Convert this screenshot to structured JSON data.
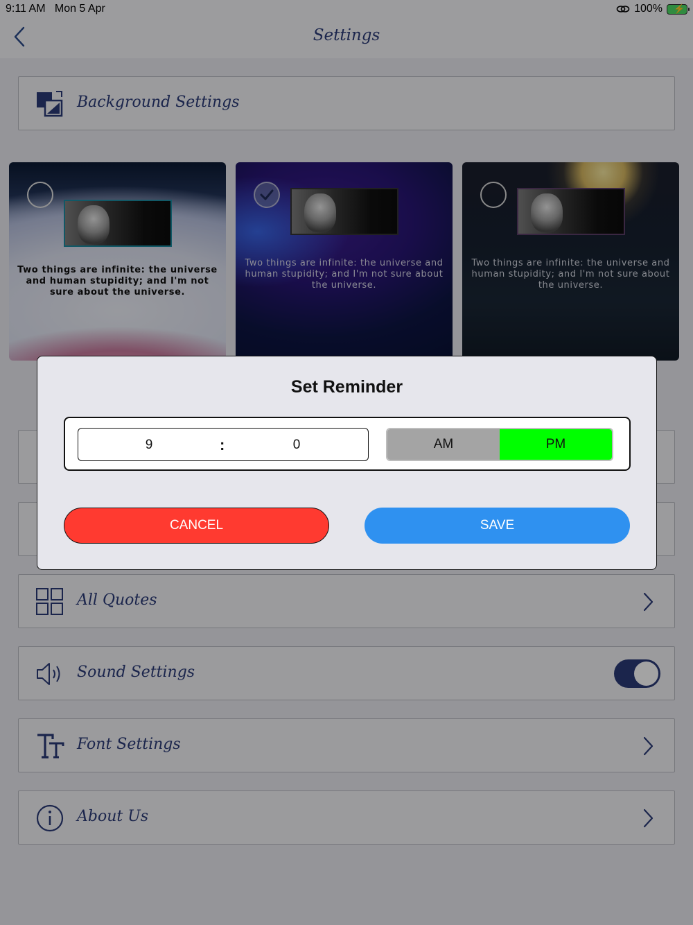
{
  "status_bar": {
    "time": "9:11 AM",
    "date": "Mon 5 Apr",
    "battery": "100%"
  },
  "nav": {
    "title": "Settings"
  },
  "background_settings": {
    "label": "Background Settings",
    "icon": "background-icon"
  },
  "backgrounds": [
    {
      "quote": "Two things are infinite: the universe and human stupidity; and I'm not sure about the universe.",
      "selected": false
    },
    {
      "quote": "Two things are infinite: the universe and human stupidity; and I'm not sure about the universe.",
      "selected": true
    },
    {
      "quote": "Two things are infinite: the universe and human stupidity; and I'm not sure about the universe.",
      "selected": false
    }
  ],
  "rows": {
    "all_quotes": {
      "label": "All Quotes",
      "icon": "grid-icon"
    },
    "sound_settings": {
      "label": "Sound Settings",
      "icon": "speaker-icon",
      "enabled": true
    },
    "font_settings": {
      "label": "Font Settings",
      "icon": "font-icon"
    },
    "about_us": {
      "label": "About Us",
      "icon": "info-icon"
    }
  },
  "dialog": {
    "title": "Set Reminder",
    "hour": "9",
    "separator": ":",
    "minute": "0",
    "am_label": "AM",
    "pm_label": "PM",
    "selected_period": "PM",
    "cancel_label": "CANCEL",
    "save_label": "SAVE"
  },
  "colors": {
    "accent": "#2b3b78",
    "cancel": "#ff3a30",
    "save": "#2f91f0",
    "pm_selected": "#00ff00"
  }
}
